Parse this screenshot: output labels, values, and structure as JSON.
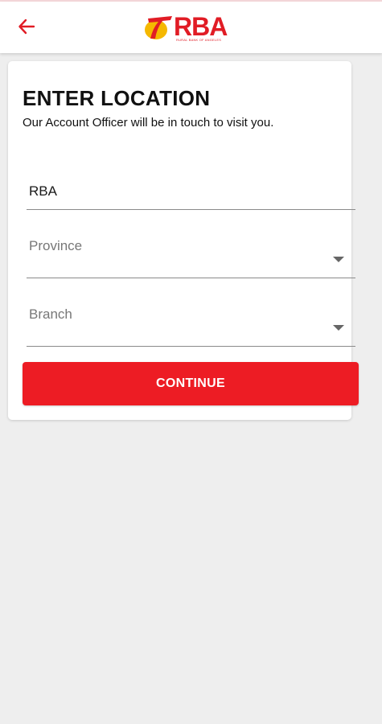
{
  "header": {
    "logo_text": "RBA",
    "logo_subtext": "RURAL BANK OF ANGELES",
    "back_icon": "arrow-left-icon",
    "accent_color": "#e11c25"
  },
  "form": {
    "title": "ENTER LOCATION",
    "subtitle": "Our Account Officer will be in touch to visit you.",
    "name_value": "RBA",
    "province_placeholder": "Province",
    "branch_placeholder": "Branch",
    "dropdown_icon": "caret-down-icon",
    "continue_label": "CONTINUE",
    "button_color": "#ed1c24"
  }
}
